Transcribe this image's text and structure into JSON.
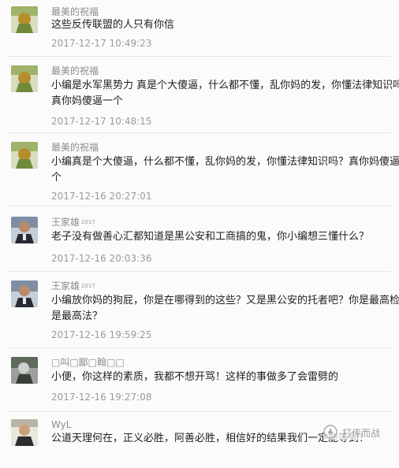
{
  "comments": [
    {
      "name": "最美的祝福",
      "badge": "",
      "text_lines": [
        "这些反传联盟的人只有你信"
      ],
      "time": "2017-12-17 10:49:23"
    },
    {
      "name": "最美的祝福",
      "badge": "",
      "text_lines": [
        "小编是水军黑势力 真是个大傻逼，什么都不懂，乱你妈的发，你懂法律知识吗？",
        "真你妈傻逼一个"
      ],
      "time": "2017-12-17 10:48:15"
    },
    {
      "name": "最美的祝福",
      "badge": "",
      "text_lines": [
        "小编真是个大傻逼，什么都不懂，乱你妈的发，你懂法律知识吗？真你妈傻逼一",
        "个"
      ],
      "time": "2017-12-16 20:27:01"
    },
    {
      "name": "王家雄",
      "badge": "2017",
      "text_lines": [
        "老子没有做善心汇都知道是黑公安和工商搞的鬼，你小编想三懂什么？"
      ],
      "time": "2017-12-16 20:03:36"
    },
    {
      "name": "王家雄",
      "badge": "2017",
      "text_lines": [
        "小编放你妈的狗屁，你是在哪得到的这些？又是黑公安的托者吧？你是最高检还",
        "是最高法？"
      ],
      "time": "2017-12-16 19:59:25"
    },
    {
      "name": "□叫□鄙□翰□□",
      "badge": "",
      "text_lines": [
        "小便，你这样的素质，我都不想开骂！这样的事做多了会雷劈的"
      ],
      "time": "2017-12-16 19:27:08"
    },
    {
      "name": "WyL",
      "badge": "",
      "text_lines": [
        "公道天理何在，正义必胜，阿善必胜，相信好的结果我们一定能等到！"
      ],
      "time": ""
    }
  ],
  "watermark": {
    "text": "打传而战",
    "icon": "fist-icon"
  }
}
